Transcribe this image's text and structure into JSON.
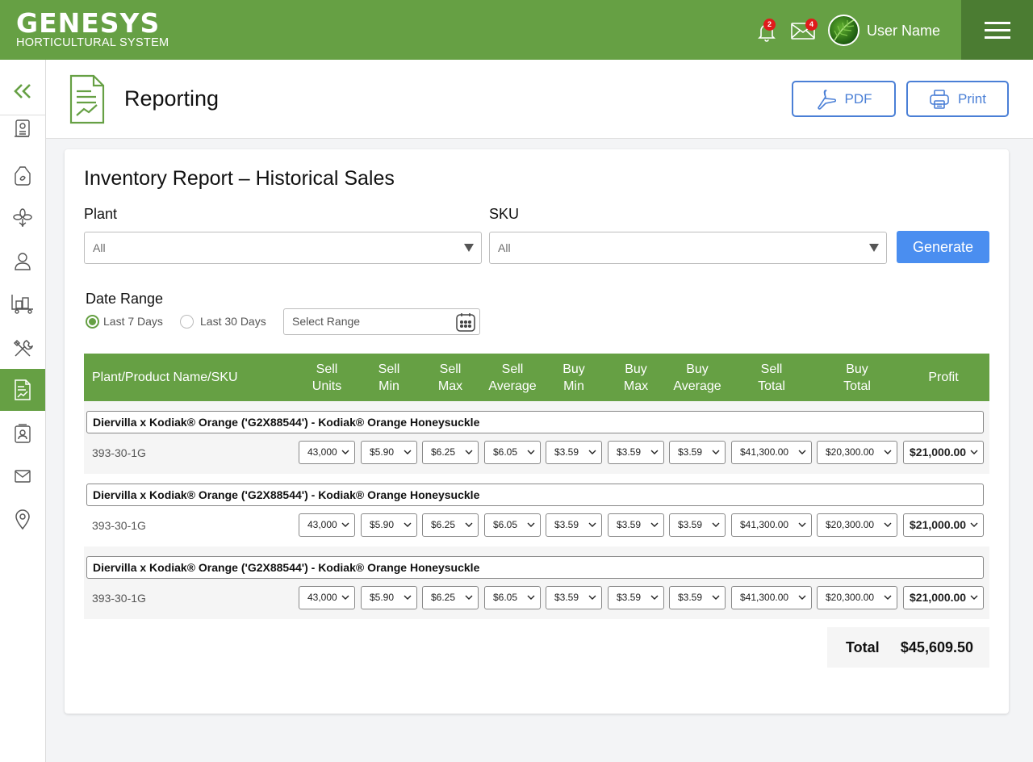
{
  "brand": {
    "name": "GENESYS",
    "subtitle": "HORTICULTURAL SYSTEM"
  },
  "topbar": {
    "notifications_count": "2",
    "messages_count": "4",
    "user_name": "User Name"
  },
  "sidebar": {
    "items": [
      "collapse",
      "orders",
      "bag",
      "plants",
      "customers",
      "inventory",
      "tools",
      "reporting",
      "contacts",
      "mail",
      "locations"
    ],
    "active": "reporting"
  },
  "header": {
    "title": "Reporting",
    "pdf_label": "PDF",
    "print_label": "Print"
  },
  "report": {
    "title": "Inventory Report – Historical Sales",
    "plant_label": "Plant",
    "plant_value": "All",
    "sku_label": "SKU",
    "sku_value": "All",
    "generate_label": "Generate",
    "date_range_label": "Date Range",
    "option_7": "Last 7 Days",
    "option_30": "Last 30 Days",
    "range_placeholder": "Select Range"
  },
  "table": {
    "columns": [
      "Plant/Product Name/SKU",
      "Sell Units",
      "Sell Min",
      "Sell Max",
      "Sell Average",
      "Buy Min",
      "Buy Max",
      "Buy Average",
      "Sell Total",
      "Buy Total",
      "Profit"
    ],
    "rows": [
      {
        "name": "Diervilla x Kodiak® Orange ('G2X88544') - Kodiak® Orange Honeysuckle",
        "sku": "393-30-1G",
        "sell_units": "43,000",
        "sell_min": "$5.90",
        "sell_max": "$6.25",
        "sell_avg": "$6.05",
        "buy_min": "$3.59",
        "buy_max": "$3.59",
        "buy_avg": "$3.59",
        "sell_total": "$41,300.00",
        "buy_total": "$20,300.00",
        "profit": "$21,000.00"
      },
      {
        "name": "Diervilla x Kodiak® Orange ('G2X88544') - Kodiak® Orange Honeysuckle",
        "sku": "393-30-1G",
        "sell_units": "43,000",
        "sell_min": "$5.90",
        "sell_max": "$6.25",
        "sell_avg": "$6.05",
        "buy_min": "$3.59",
        "buy_max": "$3.59",
        "buy_avg": "$3.59",
        "sell_total": "$41,300.00",
        "buy_total": "$20,300.00",
        "profit": "$21,000.00"
      },
      {
        "name": "Diervilla x Kodiak® Orange ('G2X88544') - Kodiak® Orange Honeysuckle",
        "sku": "393-30-1G",
        "sell_units": "43,000",
        "sell_min": "$5.90",
        "sell_max": "$6.25",
        "sell_avg": "$6.05",
        "buy_min": "$3.59",
        "buy_max": "$3.59",
        "buy_avg": "$3.59",
        "sell_total": "$41,300.00",
        "buy_total": "$20,300.00",
        "profit": "$21,000.00"
      }
    ],
    "total_label": "Total",
    "total_value": "$45,609.50"
  },
  "colors": {
    "brand_green": "#66a044",
    "dark_green": "#4b7c32",
    "accent_blue": "#4a8ef0",
    "badge_red": "#e01b1b"
  }
}
